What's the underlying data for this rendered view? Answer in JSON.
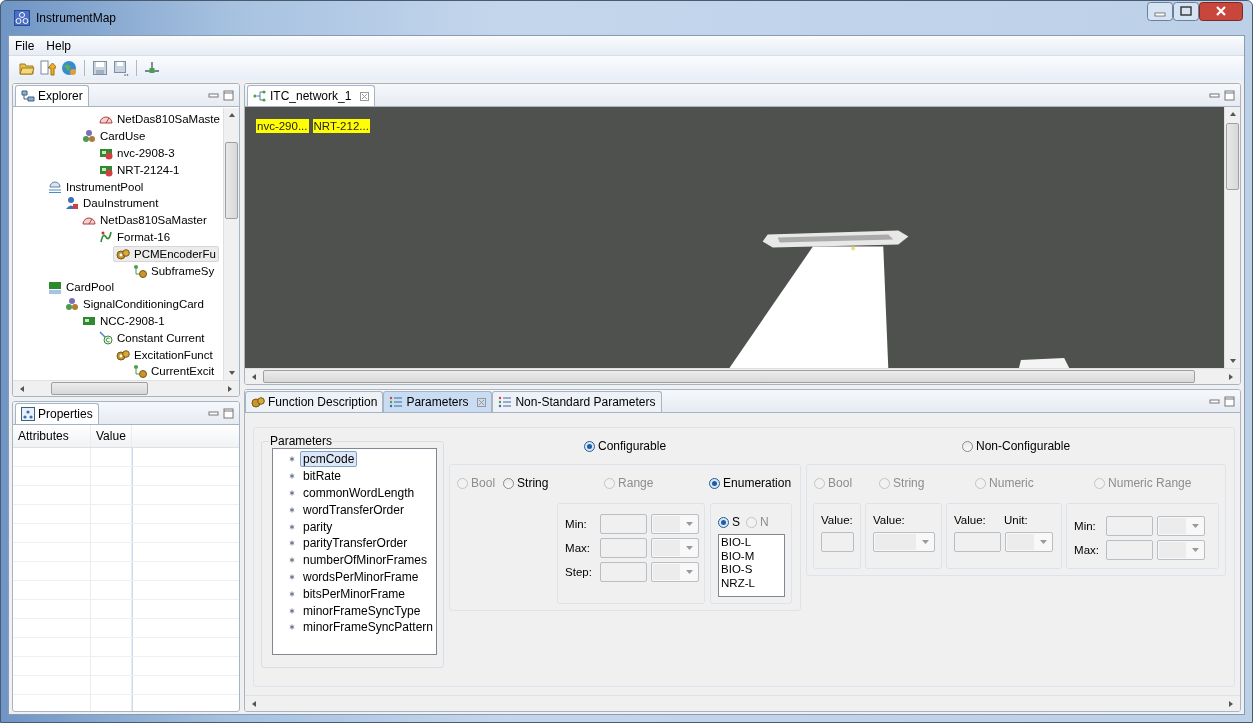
{
  "window": {
    "title": "InstrumentMap"
  },
  "menu": [
    "File",
    "Help"
  ],
  "explorer": {
    "tab": "Explorer",
    "tree": [
      {
        "children": [
          {
            "children": [
              {
                "children": [
                  {
                    "label": "NetDas810SaMaste",
                    "kind": "gauge",
                    "selected": false
                  }
                ]
              },
              {
                "label": "CardUse",
                "kind": "group",
                "selected": false,
                "children": [
                  {
                    "label": "nvc-2908-3",
                    "kind": "usedcard",
                    "selected": false
                  },
                  {
                    "label": "NRT-2124-1",
                    "kind": "usedcard",
                    "selected": false
                  }
                ]
              }
            ]
          }
        ]
      },
      {
        "label": "InstrumentPool",
        "kind": "pool",
        "selected": false,
        "children": [
          {
            "label": "DauInstrument",
            "kind": "user",
            "selected": false,
            "children": [
              {
                "label": "NetDas810SaMaster",
                "kind": "gauge",
                "selected": false,
                "children": [
                  {
                    "label": "Format-16",
                    "kind": "format",
                    "selected": false,
                    "children": [
                      {
                        "label": "PCMEncoderFu",
                        "kind": "function",
                        "selected": true,
                        "children": [
                          {
                            "label": "SubframeSy",
                            "kind": "subfunction",
                            "selected": false
                          }
                        ]
                      }
                    ]
                  }
                ]
              }
            ]
          }
        ]
      },
      {
        "label": "CardPool",
        "kind": "cardpool",
        "selected": false,
        "children": [
          {
            "label": "SignalConditioningCard",
            "kind": "group",
            "selected": false,
            "children": [
              {
                "label": "NCC-2908-1",
                "kind": "card",
                "selected": false,
                "children": [
                  {
                    "label": "Constant Current",
                    "kind": "excitation",
                    "selected": false,
                    "children": [
                      {
                        "label": "ExcitationFunct",
                        "kind": "function",
                        "selected": false,
                        "children": [
                          {
                            "label": "CurrentExcit",
                            "kind": "subfunction",
                            "selected": false
                          }
                        ]
                      }
                    ]
                  }
                ]
              }
            ]
          }
        ]
      }
    ]
  },
  "properties": {
    "tab": "Properties",
    "columns": [
      "Attributes",
      "Value"
    ]
  },
  "editor": {
    "tab": "ITC_network_1",
    "labels": [
      "nvc-290...",
      "NRT-212..."
    ]
  },
  "bottom_tabs": [
    {
      "label": "Function Description",
      "kind": "function",
      "selected": false
    },
    {
      "label": "Parameters",
      "kind": "list",
      "selected": true
    },
    {
      "label": "Non-Standard Parameters",
      "kind": "list",
      "selected": false
    }
  ],
  "parameters": {
    "title": "Parameters",
    "items": [
      {
        "label": "pcmCode",
        "selected": true
      },
      {
        "label": "bitRate",
        "selected": false
      },
      {
        "label": "commonWordLength",
        "selected": false
      },
      {
        "label": "wordTransferOrder",
        "selected": false
      },
      {
        "label": "parity",
        "selected": false
      },
      {
        "label": "parityTransferOrder",
        "selected": false
      },
      {
        "label": "numberOfMinorFrames",
        "selected": false
      },
      {
        "label": "wordsPerMinorFrame",
        "selected": false
      },
      {
        "label": "bitsPerMinorFrame",
        "selected": false
      },
      {
        "label": "minorFrameSyncType",
        "selected": false
      },
      {
        "label": "minorFrameSyncPattern",
        "selected": false
      }
    ]
  },
  "modes": [
    {
      "label": "Configurable",
      "selected": true,
      "disabled": false
    },
    {
      "label": "Non-Configurable",
      "selected": false,
      "disabled": false
    }
  ],
  "configurable": {
    "types": [
      {
        "label": "Bool",
        "selected": false,
        "disabled": true
      },
      {
        "label": "String",
        "selected": false,
        "disabled": false
      },
      {
        "label": "Range",
        "selected": false,
        "disabled": true
      },
      {
        "label": "Enumeration",
        "selected": true,
        "disabled": false
      }
    ],
    "range_fields": [
      "Min:",
      "Max:",
      "Step:"
    ],
    "enum_formats": [
      {
        "label": "S",
        "selected": true,
        "disabled": false
      },
      {
        "label": "N",
        "selected": false,
        "disabled": true
      }
    ],
    "enum_values": [
      "BIO-L",
      "BIO-M",
      "BIO-S",
      "NRZ-L"
    ]
  },
  "non_configurable": {
    "types": [
      {
        "label": "Bool",
        "selected": false,
        "disabled": true
      },
      {
        "label": "String",
        "selected": false,
        "disabled": true
      },
      {
        "label": "Numeric",
        "selected": false,
        "disabled": true
      },
      {
        "label": "Numeric Range",
        "selected": false,
        "disabled": true
      }
    ],
    "bool_label": "Value:",
    "string_label": "Value:",
    "numeric_labels": [
      "Value:",
      "Unit:"
    ],
    "range_labels": [
      "Min:",
      "Max:"
    ]
  }
}
